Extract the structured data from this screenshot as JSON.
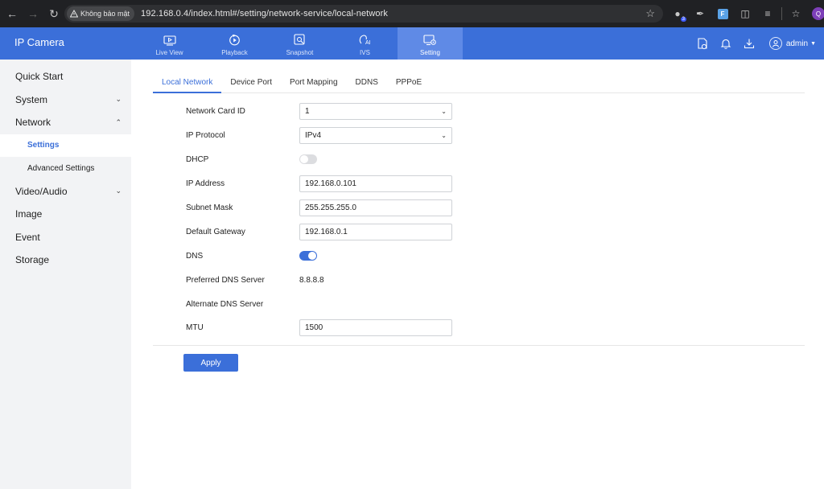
{
  "browser": {
    "security_label": "Không bảo mật",
    "url": "192.168.0.4/index.html#/setting/network-service/local-network",
    "ext_badge": "3",
    "ext_f_label": "F",
    "profile_initial": "Q"
  },
  "app": {
    "title": "IP Camera",
    "nav": [
      {
        "label": "Live View",
        "icon": "live-view-icon"
      },
      {
        "label": "Playback",
        "icon": "playback-icon"
      },
      {
        "label": "Snapshot",
        "icon": "snapshot-icon"
      },
      {
        "label": "IVS",
        "icon": "ivs-icon"
      },
      {
        "label": "Setting",
        "icon": "setting-icon",
        "active": true
      }
    ],
    "user": "admin",
    "accent_color": "#3b6fd9"
  },
  "sidebar": {
    "items": [
      {
        "label": "Quick Start"
      },
      {
        "label": "System",
        "chevron": "down"
      },
      {
        "label": "Network",
        "chevron": "up"
      },
      {
        "label": "Settings",
        "sub": true,
        "active": true
      },
      {
        "label": "Advanced Settings",
        "sub": true
      },
      {
        "label": "Video/Audio",
        "chevron": "down"
      },
      {
        "label": "Image"
      },
      {
        "label": "Event"
      },
      {
        "label": "Storage"
      }
    ]
  },
  "tabs": [
    {
      "label": "Local Network",
      "active": true
    },
    {
      "label": "Device Port"
    },
    {
      "label": "Port Mapping"
    },
    {
      "label": "DDNS"
    },
    {
      "label": "PPPoE"
    }
  ],
  "form": {
    "network_card_id": {
      "label": "Network Card ID",
      "value": "1"
    },
    "ip_protocol": {
      "label": "IP Protocol",
      "value": "IPv4"
    },
    "dhcp": {
      "label": "DHCP",
      "enabled": false
    },
    "ip_address": {
      "label": "IP Address",
      "value": "192.168.0.101"
    },
    "subnet_mask": {
      "label": "Subnet Mask",
      "value": "255.255.255.0"
    },
    "default_gateway": {
      "label": "Default Gateway",
      "value": "192.168.0.1"
    },
    "dns": {
      "label": "DNS",
      "enabled": true
    },
    "preferred_dns": {
      "label": "Preferred DNS Server",
      "value": "8.8.8.8"
    },
    "alternate_dns": {
      "label": "Alternate DNS Server",
      "value": ""
    },
    "mtu": {
      "label": "MTU",
      "value": "1500"
    }
  },
  "apply_label": "Apply"
}
